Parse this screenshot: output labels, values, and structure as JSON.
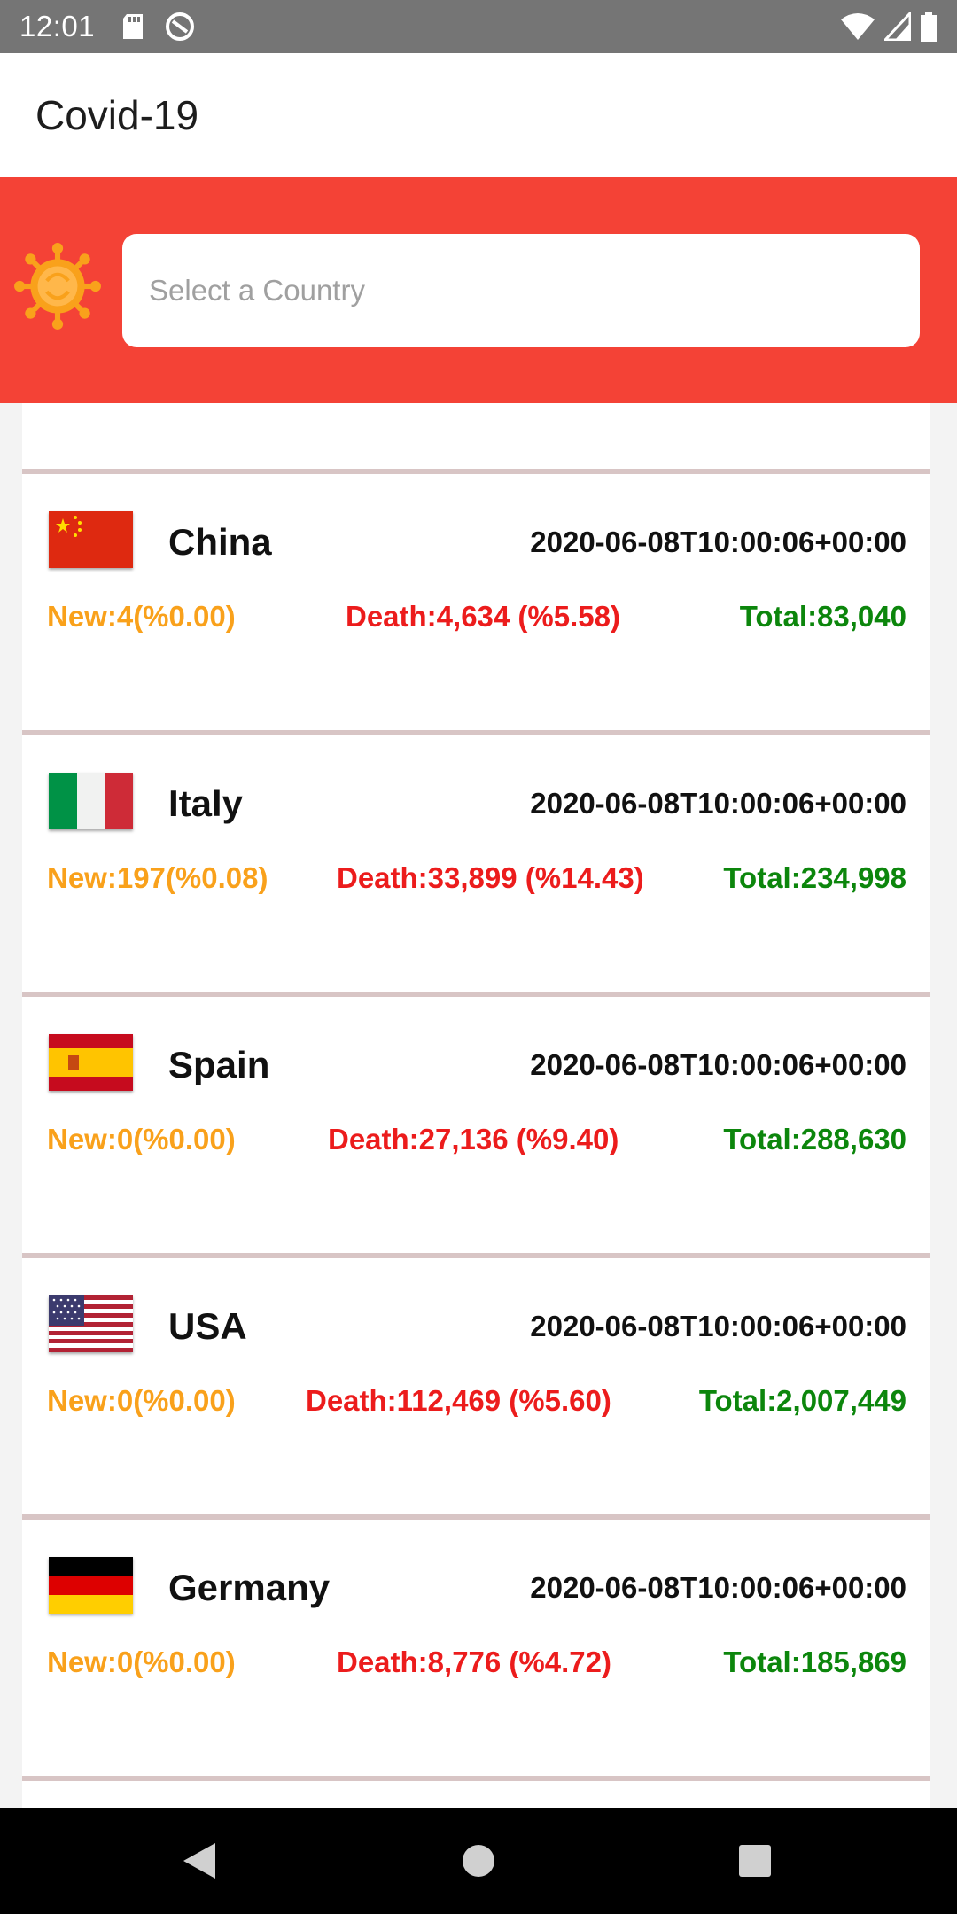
{
  "status_bar": {
    "time": "12:01",
    "icons": [
      "sd-card-icon",
      "sync-icon",
      "wifi-icon",
      "signal-icon",
      "battery-icon"
    ]
  },
  "app_bar": {
    "title": "Covid-19"
  },
  "search": {
    "placeholder": "Select a Country",
    "value": ""
  },
  "countries": [
    {
      "name": "China",
      "timestamp": "2020-06-08T10:00:06+00:00",
      "new": "New:4(%0.00)",
      "death": "Death:4,634 (%5.58)",
      "total": "Total:83,040",
      "flag": "china-flag-icon"
    },
    {
      "name": "Italy",
      "timestamp": "2020-06-08T10:00:06+00:00",
      "new": "New:197(%0.08)",
      "death": "Death:33,899 (%14.43)",
      "total": "Total:234,998",
      "flag": "italy-flag-icon"
    },
    {
      "name": "Spain",
      "timestamp": "2020-06-08T10:00:06+00:00",
      "new": "New:0(%0.00)",
      "death": "Death:27,136 (%9.40)",
      "total": "Total:288,630",
      "flag": "spain-flag-icon"
    },
    {
      "name": "USA",
      "timestamp": "2020-06-08T10:00:06+00:00",
      "new": "New:0(%0.00)",
      "death": "Death:112,469 (%5.60)",
      "total": "Total:2,007,449",
      "flag": "usa-flag-icon"
    },
    {
      "name": "Germany",
      "timestamp": "2020-06-08T10:00:06+00:00",
      "new": "New:0(%0.00)",
      "death": "Death:8,776 (%4.72)",
      "total": "Total:185,869",
      "flag": "germany-flag-icon"
    }
  ],
  "colors": {
    "banner": "#f44236",
    "new": "#f9a11b",
    "death": "#ec1c1c",
    "total": "#0c860c"
  },
  "nav_bar": {
    "buttons": [
      "back-icon",
      "home-icon",
      "recents-icon"
    ]
  }
}
